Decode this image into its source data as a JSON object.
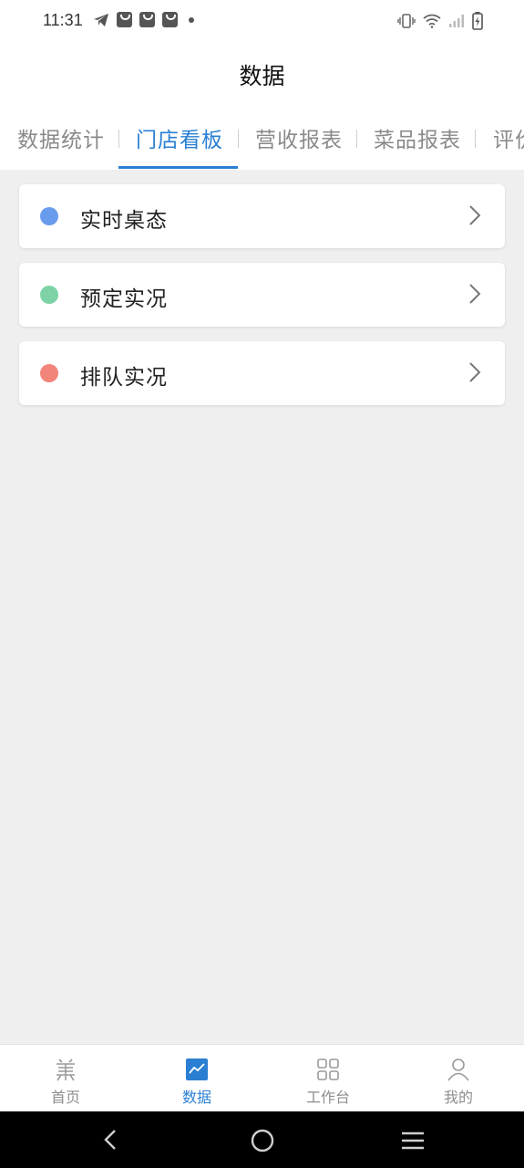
{
  "status_bar": {
    "time": "11:31",
    "left_icons": [
      "telegram-icon",
      "bag-icon",
      "bag-icon",
      "bag-icon",
      "dot-icon"
    ],
    "right_icons": [
      "vibrate-icon",
      "wifi-icon",
      "signal-icon",
      "battery-charging-icon"
    ]
  },
  "header": {
    "title": "数据"
  },
  "tabs": [
    {
      "label": "数据统计",
      "active": false
    },
    {
      "label": "门店看板",
      "active": true
    },
    {
      "label": "营收报表",
      "active": false
    },
    {
      "label": "菜品报表",
      "active": false
    },
    {
      "label": "评价",
      "active": false
    }
  ],
  "cards": [
    {
      "label": "实时桌态",
      "dot_color": "#6a9cee"
    },
    {
      "label": "预定实况",
      "dot_color": "#7dd3a6"
    },
    {
      "label": "排队实况",
      "dot_color": "#f2857a"
    }
  ],
  "bottom_nav": [
    {
      "label": "首页",
      "icon": "home-logo-icon",
      "active": false
    },
    {
      "label": "数据",
      "icon": "chart-icon",
      "active": true
    },
    {
      "label": "工作台",
      "icon": "grid-icon",
      "active": false
    },
    {
      "label": "我的",
      "icon": "user-icon",
      "active": false
    }
  ],
  "colors": {
    "accent": "#2a7fd3",
    "background": "#efefef"
  }
}
